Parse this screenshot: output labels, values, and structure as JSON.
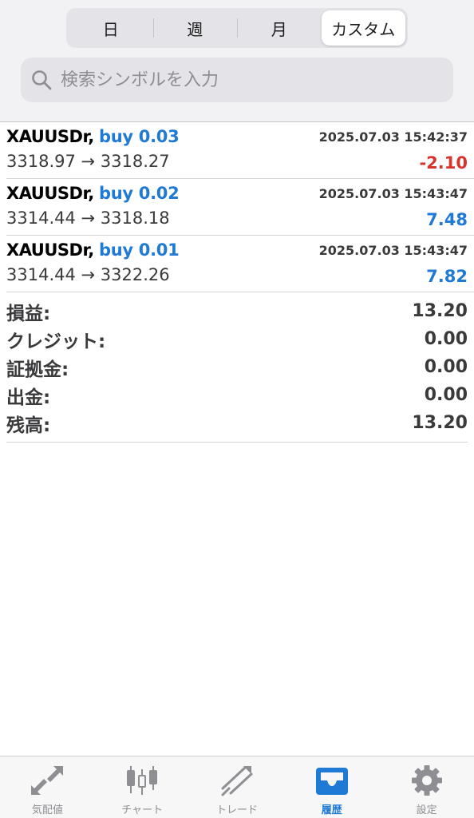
{
  "period_tabs": [
    "日",
    "週",
    "月",
    "カスタム"
  ],
  "search": {
    "placeholder": "検索シンボルを入力"
  },
  "deals": [
    {
      "symbol": "XAUUSDr,",
      "side": "buy 0.03",
      "time": "2025.07.03 15:42:37",
      "prices": "3318.97 → 3318.27",
      "profit": "-2.10",
      "profit_color": "#d9342b"
    },
    {
      "symbol": "XAUUSDr,",
      "side": "buy 0.02",
      "time": "2025.07.03 15:43:47",
      "prices": "3314.44 → 3318.18",
      "profit": "7.48",
      "profit_color": "#1f7ad6"
    },
    {
      "symbol": "XAUUSDr,",
      "side": "buy 0.01",
      "time": "2025.07.03 15:43:47",
      "prices": "3314.44 → 3322.26",
      "profit": "7.82",
      "profit_color": "#1f7ad6"
    }
  ],
  "summary": [
    {
      "label": "損益:",
      "value": "13.20"
    },
    {
      "label": "クレジット:",
      "value": "0.00"
    },
    {
      "label": "証拠金:",
      "value": "0.00"
    },
    {
      "label": "出金:",
      "value": "0.00"
    },
    {
      "label": "残高:",
      "value": "13.20"
    }
  ],
  "tabbar": [
    {
      "label": "気配値",
      "icon": "quotes-icon"
    },
    {
      "label": "チャート",
      "icon": "candlestick-icon"
    },
    {
      "label": "トレード",
      "icon": "trade-icon"
    },
    {
      "label": "履歴",
      "icon": "inbox-icon"
    },
    {
      "label": "設定",
      "icon": "gear-icon"
    }
  ],
  "colors": {
    "accent": "#1f7ad6",
    "loss": "#d9342b",
    "inactive": "#8e8e93"
  }
}
